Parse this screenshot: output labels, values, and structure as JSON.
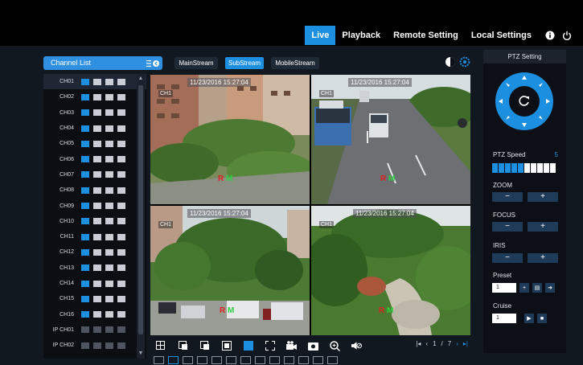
{
  "nav": {
    "items": [
      {
        "label": "Live",
        "active": true
      },
      {
        "label": "Playback",
        "active": false
      },
      {
        "label": "Remote Setting",
        "active": false
      },
      {
        "label": "Local Settings",
        "active": false
      }
    ],
    "icons": [
      "info-icon",
      "power-icon"
    ]
  },
  "channel_list": {
    "title": "Channel List",
    "channels": [
      "CH01",
      "CH02",
      "CH03",
      "CH04",
      "CH05",
      "CH06",
      "CH07",
      "CH08",
      "CH09",
      "CH10",
      "CH11",
      "CH12",
      "CH13",
      "CH14",
      "CH15",
      "CH16",
      "IP CH01",
      "IP CH02"
    ],
    "selected": "CH01"
  },
  "streams": {
    "main": "MainStream",
    "sub": "SubStream",
    "mobile": "MobileStream",
    "active": "SubStream"
  },
  "video": {
    "cells": [
      {
        "timestamp": "11/23/2016 15:27:04",
        "channel": "CH1",
        "rec": "R",
        "motion": "M"
      },
      {
        "timestamp": "11/23/2016 15:27:04",
        "channel": "CH1",
        "rec": "R",
        "motion": "M"
      },
      {
        "timestamp": "11/23/2016 15:27:04",
        "channel": "CH1",
        "rec": "R",
        "motion": "M"
      },
      {
        "timestamp": "11/23/2016 15:27:04",
        "channel": "CH1",
        "rec": "R",
        "motion": "M"
      }
    ]
  },
  "pager": {
    "current": "1",
    "separator": "/",
    "total": "7"
  },
  "ptz": {
    "title": "PTZ Setting",
    "speed_label": "PTZ Speed",
    "speed_value": "5",
    "speed_level": 5,
    "speed_segments": 10,
    "zoom_label": "ZOOM",
    "focus_label": "FOCUS",
    "iris_label": "IRIS",
    "preset_label": "Preset",
    "preset_value": "1",
    "cruise_label": "Cruise",
    "cruise_value": "1",
    "minus": "−",
    "plus": "+"
  },
  "colors": {
    "accent": "#1d8fe0",
    "rec": "#e02020",
    "motion": "#2ed040"
  }
}
